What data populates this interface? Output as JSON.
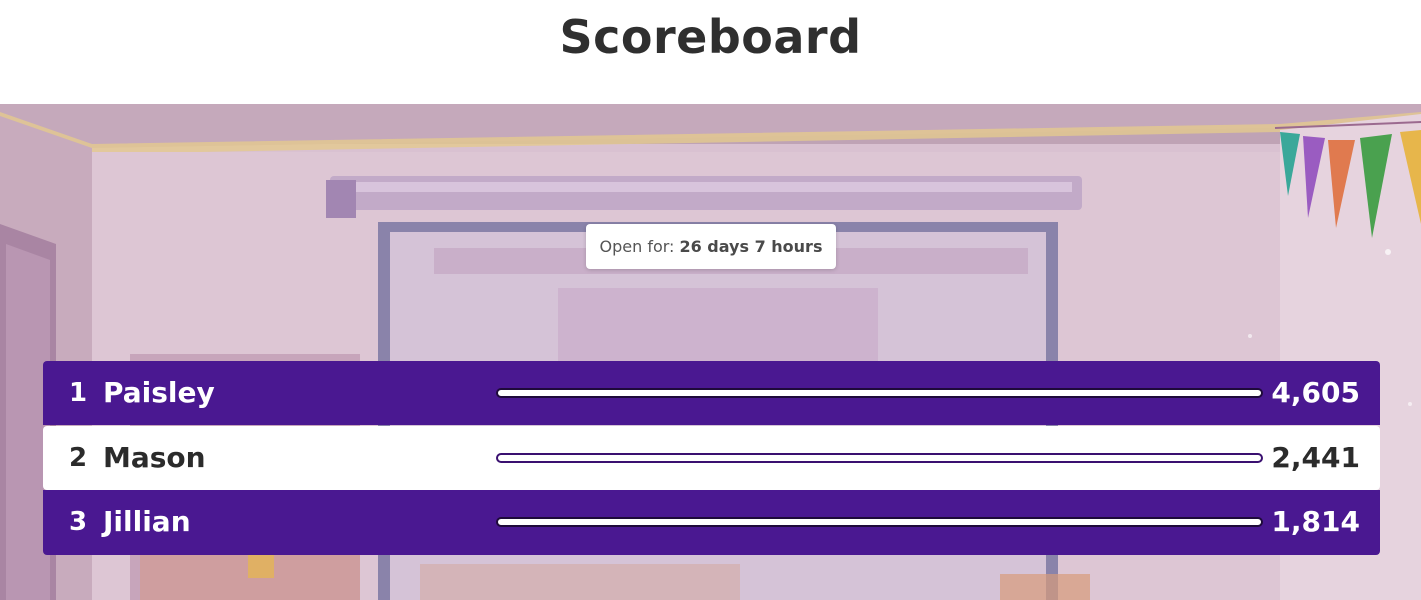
{
  "page": {
    "title": "Scoreboard"
  },
  "timer": {
    "label": "Open for:",
    "value": "26 days 7 hours"
  },
  "leaderboard": {
    "max_score": 4605,
    "rows": [
      {
        "rank": "1",
        "name": "Paisley",
        "score": "4,605",
        "score_value": 4605,
        "progress": 1.0
      },
      {
        "rank": "2",
        "name": "Mason",
        "score": "2,441",
        "score_value": 2441,
        "progress": 1.0
      },
      {
        "rank": "3",
        "name": "Jillian",
        "score": "1,814",
        "score_value": 1814,
        "progress": 1.0
      }
    ]
  },
  "colors": {
    "primary_purple": "#4a1891",
    "title_text": "#2f2f2f",
    "background_scene": "#d9c1d1"
  }
}
